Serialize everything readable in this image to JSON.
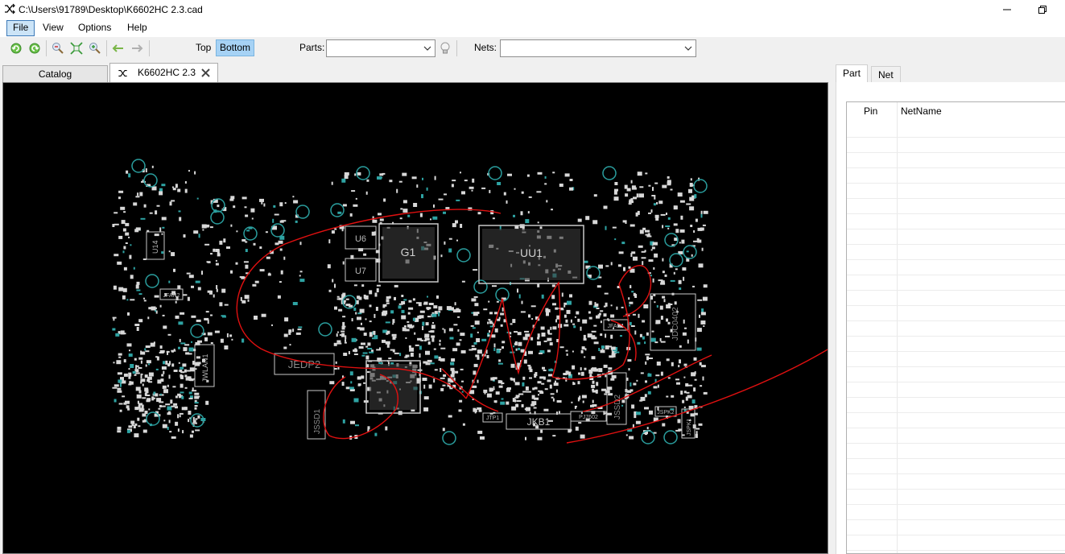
{
  "window": {
    "title": "C:\\Users\\91789\\Desktop\\K6602HC 2.3.cad",
    "app_icon": "shuffle-icon",
    "minimize_icon": "minimize-icon",
    "restore_icon": "restore-icon"
  },
  "menu": {
    "items": [
      {
        "label": "File",
        "active": true
      },
      {
        "label": "View",
        "active": false
      },
      {
        "label": "Options",
        "active": false
      },
      {
        "label": "Help",
        "active": false
      }
    ]
  },
  "toolbar": {
    "icons": [
      "rotate-left-icon",
      "rotate-right-icon",
      "zoom-out-icon",
      "fit-view-icon",
      "zoom-in-icon",
      "back-arrow-icon",
      "forward-arrow-icon"
    ],
    "side_top_label": "Top",
    "side_bottom_label": "Bottom",
    "side_selected": "Bottom",
    "parts_label": "Parts:",
    "parts_value": "",
    "bulb_icon": "lightbulb-icon",
    "nets_label": "Nets:",
    "nets_value": ""
  },
  "tabs": {
    "catalog_label": "Catalog",
    "doc_label": "K6602HC 2.3",
    "doc_icon": "shuffle-icon",
    "close_icon": "close-icon"
  },
  "board": {
    "labels": {
      "u14": "U14",
      "g1": "G1",
      "uu1": "UU1",
      "u6": "U6",
      "u7": "U7",
      "jedp": "JEDP2",
      "jwlan": "JWLAN1",
      "jkb": "JKB1",
      "jssd1": "JSSD1",
      "jssd2": "JSSD2",
      "jdc": "JDC0402",
      "jfan2": "JFAN2",
      "jfan1": "JFAN1",
      "jspk1": "JSPK1",
      "jspk2": "JSPK2",
      "pj": "PJ7602",
      "jtp": "JTP1"
    },
    "accent_color": "#e01010",
    "component_color": "#c8c8c8"
  },
  "side_panel": {
    "tab_part": "Part",
    "tab_net": "Net",
    "active_tab": "Part",
    "columns": [
      "Pin",
      "NetName"
    ],
    "rows": []
  }
}
